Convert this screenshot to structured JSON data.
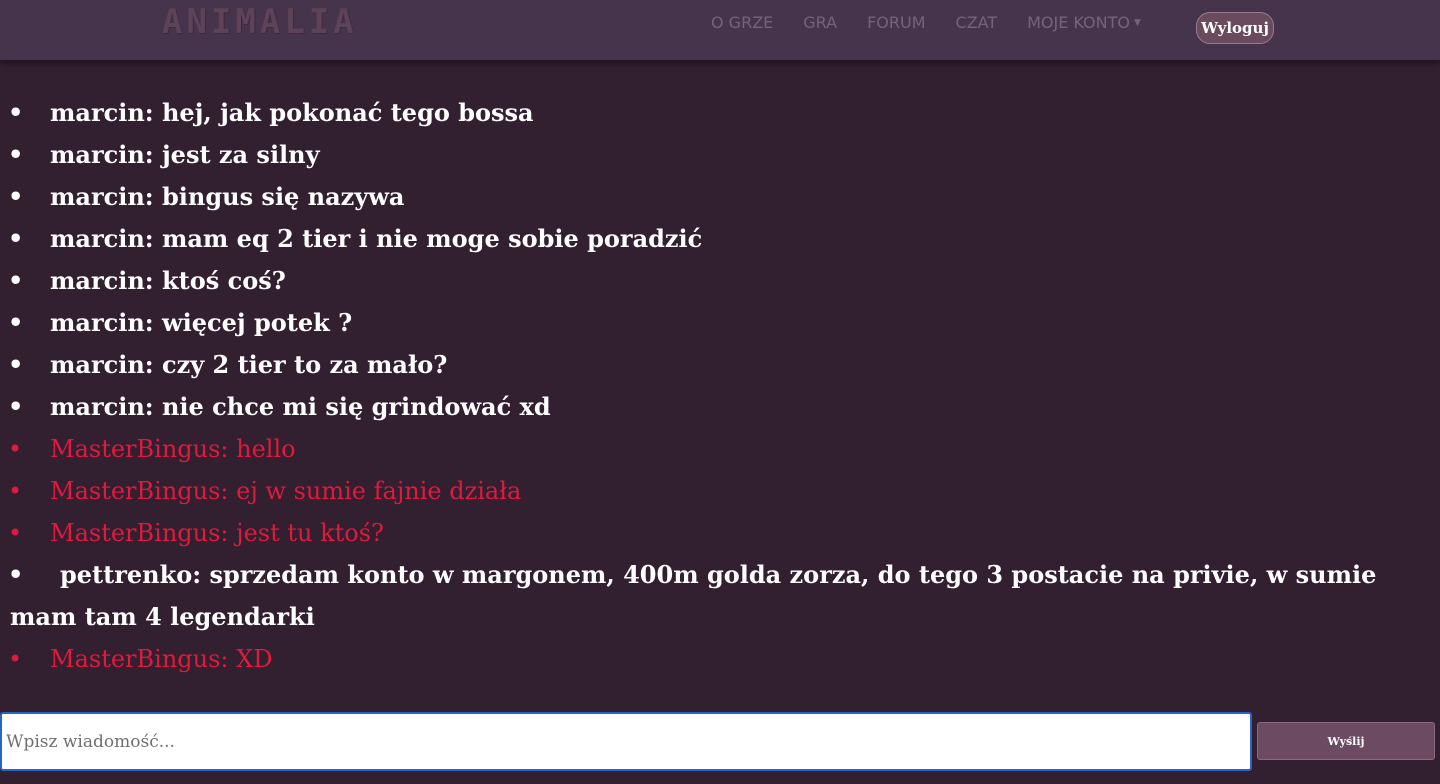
{
  "header": {
    "logo": "ANIMALIA",
    "nav": [
      "O GRZE",
      "GRA",
      "FORUM",
      "CZAT"
    ],
    "account_label": "MOJE KONTO",
    "logout_label": "Wyloguj"
  },
  "chat": {
    "messages": [
      {
        "text": "marcin: hej, jak pokonać tego bossa",
        "color": "#ffffff"
      },
      {
        "text": "marcin: jest za silny",
        "color": "#ffffff"
      },
      {
        "text": "marcin: bingus się nazywa",
        "color": "#ffffff"
      },
      {
        "text": "marcin: mam eq 2 tier i nie moge sobie poradzić",
        "color": "#ffffff"
      },
      {
        "text": "marcin: ktoś coś?",
        "color": "#ffffff"
      },
      {
        "text": "marcin: więcej potek ?",
        "color": "#ffffff"
      },
      {
        "text": "marcin: czy 2 tier to za mało?",
        "color": "#ffffff"
      },
      {
        "text": "marcin: nie chce mi się grindować xd",
        "color": "#ffffff"
      },
      {
        "text": "MasterBingus: hello",
        "color": "#e01a3c"
      },
      {
        "text": "MasterBingus: ej w sumie fajnie działa",
        "color": "#e01a3c"
      },
      {
        "text": "MasterBingus: jest tu ktoś?",
        "color": "#e01a3c"
      },
      {
        "text": "pettrenko: sprzedam konto w margonem, 400m golda zorza, do tego 3 postacie na privie, w sumie mam tam 4 legendarki",
        "color": "#ffffff"
      },
      {
        "text": "MasterBingus: XD",
        "color": "#e01a3c"
      }
    ]
  },
  "composer": {
    "placeholder": "Wpisz wiadomość...",
    "send_label": "Wyślij"
  }
}
